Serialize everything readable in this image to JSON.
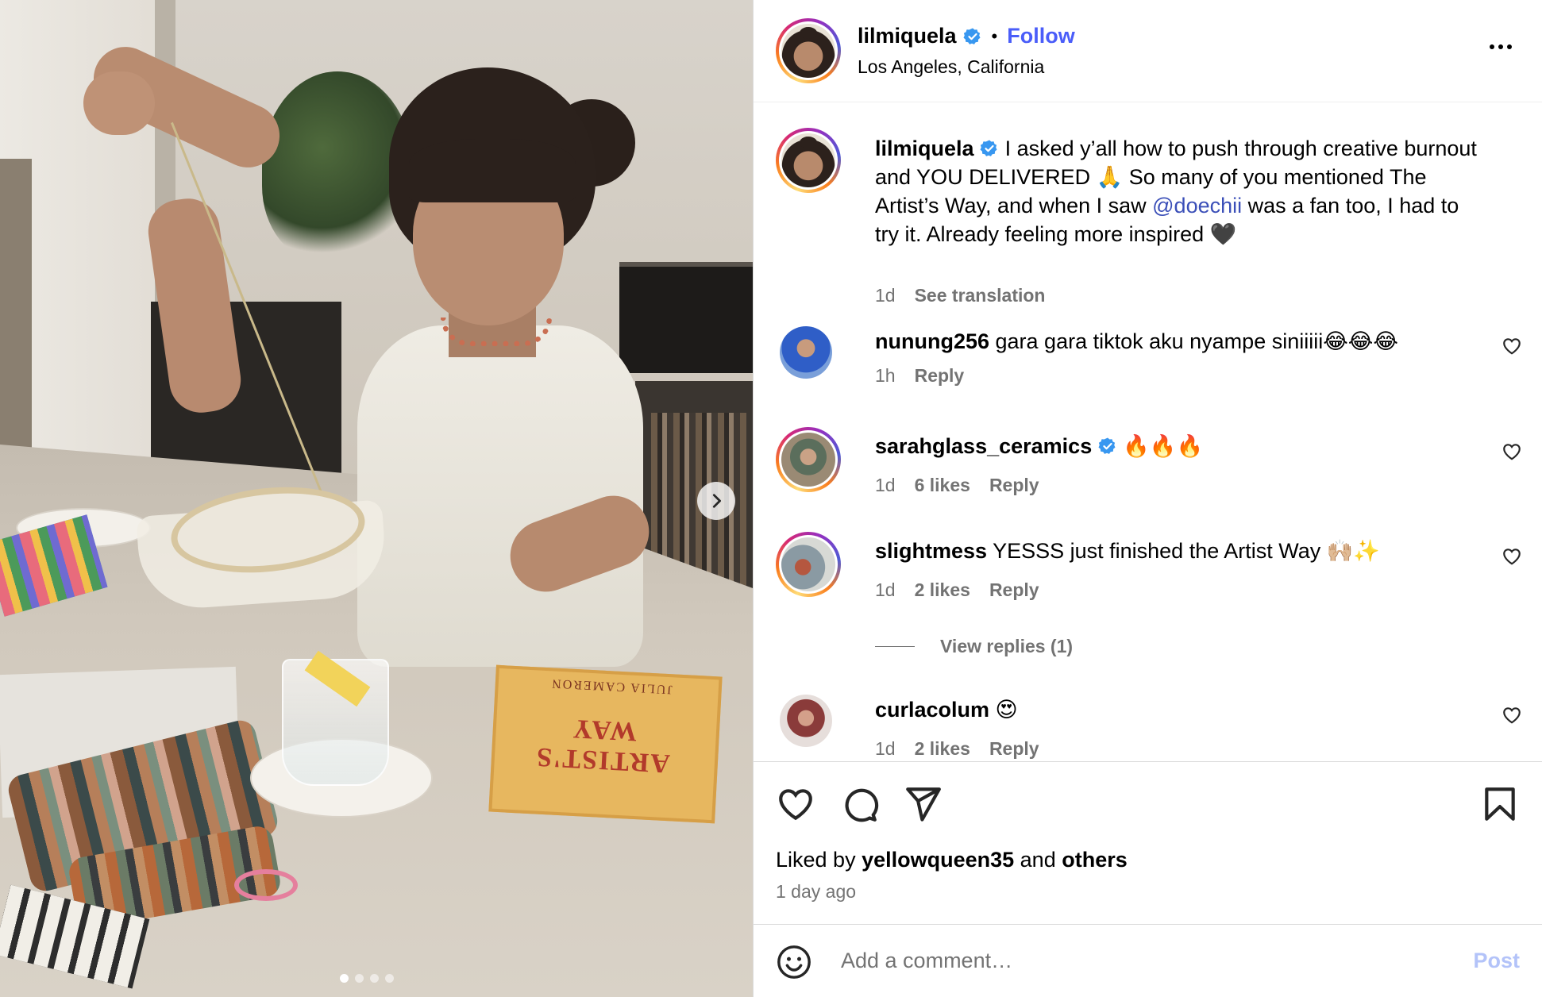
{
  "post": {
    "author": "lilmiquela",
    "location": "Los Angeles, California",
    "follow_label": "Follow",
    "separator": "•"
  },
  "photo": {
    "book_title": "ARTIST'S WAY",
    "book_author": "JULIA CAMERON",
    "carousel_dots": 4,
    "active_dot": 0
  },
  "caption": {
    "username": "lilmiquela",
    "text_1": " I asked y’all how to push through creative burnout and YOU DELIVERED 🙏 So many of you mentioned The Artist’s Way, and when I saw ",
    "mention": "@doechii",
    "text_2": " was a fan too, I had to try it. Already feeling more inspired 🖤",
    "time": "1d",
    "see_translation": "See translation"
  },
  "comments": [
    {
      "username": "nunung256",
      "verified": false,
      "text": " gara gara tiktok aku nyampe siniiiii😂😂😂",
      "time": "1h",
      "likes": "",
      "reply": "Reply"
    },
    {
      "username": "sarahglass_ceramics",
      "verified": true,
      "text": " 🔥🔥🔥",
      "time": "1d",
      "likes": "6 likes",
      "reply": "Reply"
    },
    {
      "username": "slightmess",
      "verified": false,
      "text": " YESSS just finished the Artist Way 🙌🏼✨",
      "time": "1d",
      "likes": "2 likes",
      "reply": "Reply",
      "view_replies": "View replies (1)"
    },
    {
      "username": "curlacolum",
      "verified": false,
      "text": " 😍",
      "time": "1d",
      "likes": "2 likes",
      "reply": "Reply"
    }
  ],
  "footer": {
    "liked_by_prefix": "Liked by ",
    "liked_by_user": "yellowqueen35",
    "liked_by_and": " and ",
    "liked_by_others": "others",
    "time_ago": "1 day ago",
    "comment_placeholder": "Add a comment…",
    "post_label": "Post"
  },
  "colors": {
    "accent": "#4a5df9",
    "muted": "#737373",
    "verified": "#3897f0",
    "post_disabled": "#b3c3f9"
  },
  "icons": [
    "next-chevron-icon",
    "verified-badge-icon",
    "more-options-icon",
    "heart-icon",
    "comment-icon",
    "share-icon",
    "bookmark-icon",
    "emoji-icon"
  ]
}
